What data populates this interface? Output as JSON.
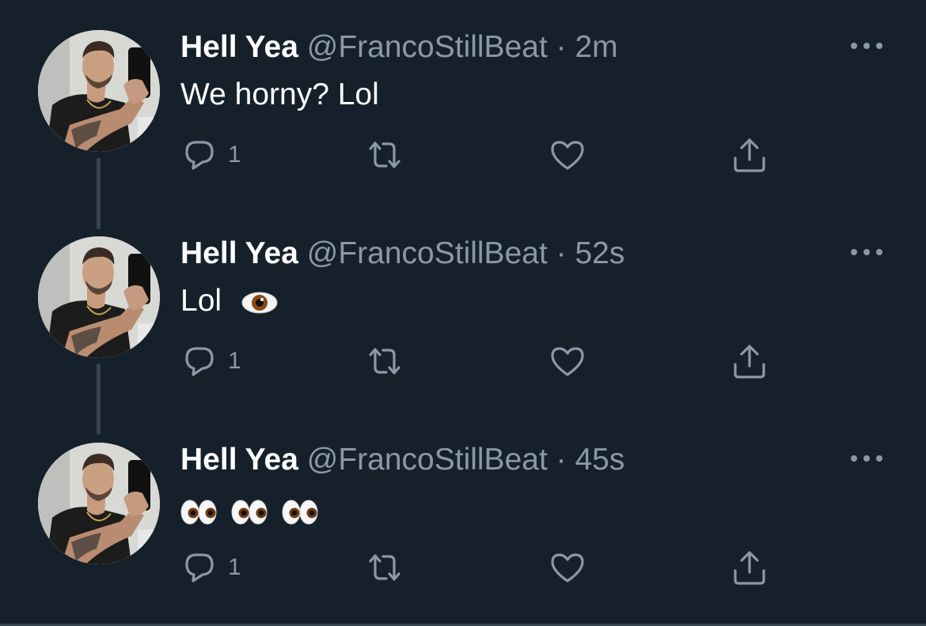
{
  "colors": {
    "background": "#15202b",
    "text_primary": "#ffffff",
    "text_secondary": "#8b98a5",
    "thread_line": "#38444d"
  },
  "tweets": [
    {
      "name": "Hell Yea",
      "handle": "@FrancoStillBeat",
      "separator": "·",
      "time": "2m",
      "text": "We horny? Lol",
      "emoji": [],
      "reply_count": "1",
      "icons": [
        "reply-icon",
        "retweet-icon",
        "like-icon",
        "share-icon",
        "more-icon"
      ]
    },
    {
      "name": "Hell Yea",
      "handle": "@FrancoStillBeat",
      "separator": "·",
      "time": "52s",
      "text": "Lol",
      "emoji": [
        "eye-emoji"
      ],
      "reply_count": "1",
      "icons": [
        "reply-icon",
        "retweet-icon",
        "like-icon",
        "share-icon",
        "more-icon"
      ]
    },
    {
      "name": "Hell Yea",
      "handle": "@FrancoStillBeat",
      "separator": "·",
      "time": "45s",
      "text": "",
      "emoji": [
        "eyes-emoji",
        "eyes-emoji",
        "eyes-emoji"
      ],
      "reply_count": "1",
      "icons": [
        "reply-icon",
        "retweet-icon",
        "like-icon",
        "share-icon",
        "more-icon"
      ]
    }
  ]
}
